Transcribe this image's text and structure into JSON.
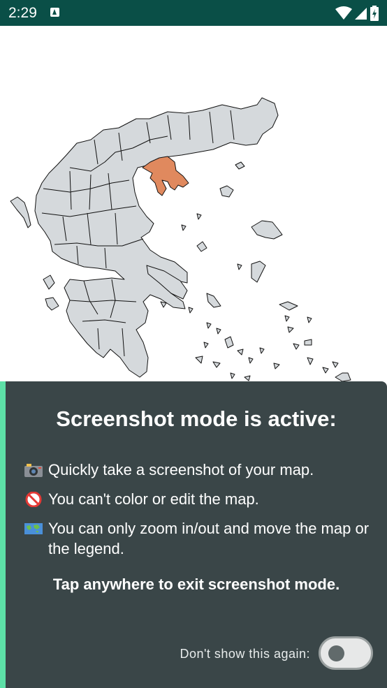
{
  "status_bar": {
    "time": "2:29",
    "icons": [
      "app-notification-icon",
      "wifi-icon",
      "signal-icon",
      "battery-charging-icon"
    ]
  },
  "map": {
    "region": "Greece",
    "highlighted_fill": "#e0895e",
    "region_fill": "#d5d9dc",
    "border_color": "#111111"
  },
  "overlay": {
    "title": "Screenshot mode is active:",
    "tips": [
      {
        "icon": "camera-icon",
        "text": "Quickly take a screenshot of your map."
      },
      {
        "icon": "no-entry-icon",
        "text": "You can't color or edit the map."
      },
      {
        "icon": "world-map-icon",
        "text": "You can only zoom in/out and move the map or the legend."
      }
    ],
    "exit_hint": "Tap anywhere to exit screenshot mode.",
    "dont_show_label": "Don't show this again:",
    "dont_show_toggle_on": false,
    "accent_color": "#5de0a7",
    "panel_color": "#3a4648"
  }
}
